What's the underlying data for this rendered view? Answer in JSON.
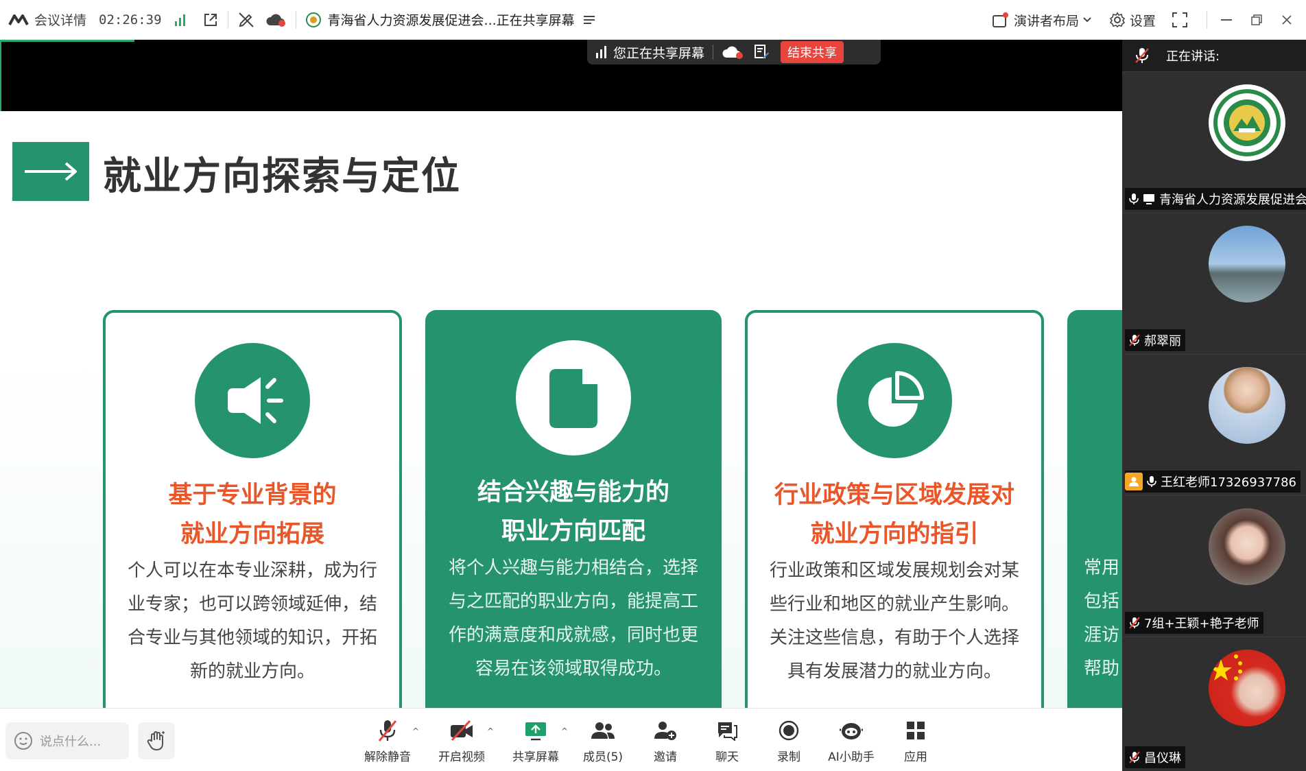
{
  "topbar": {
    "meeting_details": "会议详情",
    "timer": "02:26:39",
    "meeting_title": "青海省人力资源发展促进会...正在共享屏幕",
    "layout_label": "演讲者布局",
    "settings_label": "设置"
  },
  "share_toolbar": {
    "status": "您正在共享屏幕",
    "end_label": "结束共享"
  },
  "slide": {
    "title": "就业方向探索与定位",
    "cards": [
      {
        "icon": "speaker-icon",
        "heading_line1": "基于专业背景的",
        "heading_line2": "就业方向拓展",
        "body_lines": [
          "个人可以在本专业深耕，成为行",
          "业专家；也可以跨领域延伸，结",
          "合专业与其他领域的知识，开拓",
          "新的就业方向。"
        ]
      },
      {
        "icon": "document-icon",
        "heading_line1": "结合兴趣与能力的",
        "heading_line2": "职业方向匹配",
        "body_lines": [
          "将个人兴趣与能力相结合，选择",
          "与之匹配的职业方向，能提高工",
          "作的满意度和成就感，同时也更",
          "容易在该领域取得成功。"
        ]
      },
      {
        "icon": "pie-chart-icon",
        "heading_line1": "行业政策与区域发展对",
        "heading_line2": "就业方向的指引",
        "body_lines": [
          "行业政策和区域发展规划会对某",
          "些行业和地区的就业产生影响。",
          "关注这些信息，有助于个人选择",
          "具有发展潜力的就业方向。"
        ]
      },
      {
        "body_lines": [
          "常用",
          "包括",
          "涯访",
          "帮助"
        ]
      }
    ]
  },
  "bottombar": {
    "chat_placeholder": "说点什么...",
    "unmute": "解除静音",
    "start_video": "开启视频",
    "share_screen": "共享屏幕",
    "members": "成员(5)",
    "invite": "邀请",
    "chat": "聊天",
    "record": "录制",
    "ai_assistant": "AI小助手",
    "apps": "应用"
  },
  "video_panel": {
    "speaking_label": "正在讲话:",
    "participants": [
      {
        "name": "青海省人力资源发展促进会"
      },
      {
        "name": "郝翠丽"
      },
      {
        "name": "王红老师17326937786"
      },
      {
        "name": "7组+王颖+艳子老师"
      },
      {
        "name": "昌仪琳"
      }
    ]
  },
  "colors": {
    "accent_green": "#24936e",
    "heading_orange": "#e8562a",
    "end_share_red": "#e8453c"
  }
}
